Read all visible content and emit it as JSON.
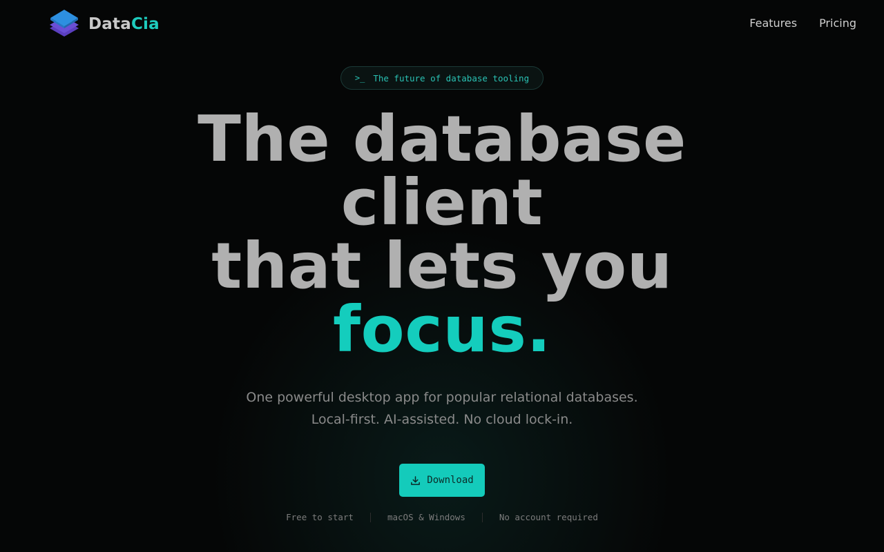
{
  "brand": {
    "name_part1": "Data",
    "name_part2": "Cia",
    "logo_icon": "layers-icon"
  },
  "nav": {
    "items": [
      {
        "label": "Features"
      },
      {
        "label": "Pricing"
      }
    ]
  },
  "badge": {
    "icon": "terminal-icon",
    "glyph": ">_",
    "text": "The future of database tooling"
  },
  "hero": {
    "line1": "The database",
    "line2": "client",
    "line3": "that lets you",
    "accent": "focus."
  },
  "subtitle": "One powerful desktop app for popular relational databases. Local-first. AI-assisted. No cloud lock-in.",
  "cta": {
    "label": "Download",
    "icon": "download-icon"
  },
  "meta": {
    "items": [
      "Free to start",
      "macOS & Windows",
      "No account required"
    ]
  },
  "colors": {
    "accent": "#14cdbd",
    "background": "#050606",
    "headline": "#b0b0b0"
  }
}
